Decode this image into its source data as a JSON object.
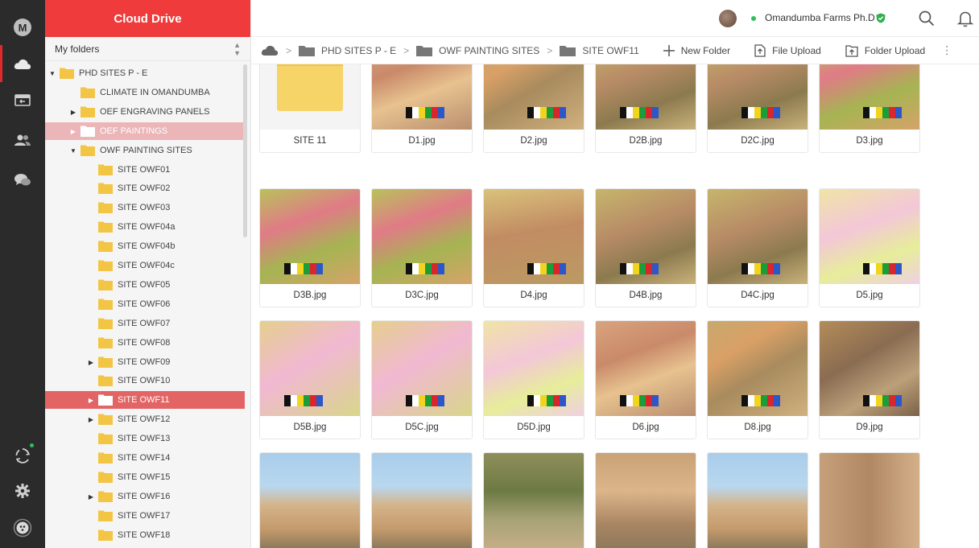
{
  "app": {
    "title": "Cloud Drive"
  },
  "tree": {
    "header": "My folders",
    "rows": [
      {
        "label": "PHD SITES P - E",
        "caret": "down",
        "depth": 0,
        "state": ""
      },
      {
        "label": "CLIMATE IN OMANDUMBA",
        "caret": "",
        "depth": 1,
        "state": ""
      },
      {
        "label": "OEF ENGRAVING PANELS",
        "caret": "right",
        "depth": 1,
        "state": ""
      },
      {
        "label": "OEF PAINTINGS",
        "caret": "right",
        "depth": 1,
        "state": "highlighted"
      },
      {
        "label": "OWF PAINTING SITES",
        "caret": "down",
        "depth": 1,
        "state": ""
      },
      {
        "label": "SITE OWF01",
        "caret": "",
        "depth": 2,
        "state": ""
      },
      {
        "label": "SITE OWF02",
        "caret": "",
        "depth": 2,
        "state": ""
      },
      {
        "label": "SITE OWF03",
        "caret": "",
        "depth": 2,
        "state": ""
      },
      {
        "label": "SITE OWF04a",
        "caret": "",
        "depth": 2,
        "state": ""
      },
      {
        "label": "SITE OWF04b",
        "caret": "",
        "depth": 2,
        "state": ""
      },
      {
        "label": "SITE OWF04c",
        "caret": "",
        "depth": 2,
        "state": ""
      },
      {
        "label": "SITE OWF05",
        "caret": "",
        "depth": 2,
        "state": ""
      },
      {
        "label": "SITE OWF06",
        "caret": "",
        "depth": 2,
        "state": ""
      },
      {
        "label": "SITE OWF07",
        "caret": "",
        "depth": 2,
        "state": ""
      },
      {
        "label": "SITE OWF08",
        "caret": "",
        "depth": 2,
        "state": ""
      },
      {
        "label": "SITE OWF09",
        "caret": "right",
        "depth": 2,
        "state": ""
      },
      {
        "label": "SITE OWF10",
        "caret": "",
        "depth": 2,
        "state": ""
      },
      {
        "label": "SITE OWF11",
        "caret": "right",
        "depth": 2,
        "state": "selected"
      },
      {
        "label": "SITE OWF12",
        "caret": "right",
        "depth": 2,
        "state": ""
      },
      {
        "label": "SITE OWF13",
        "caret": "",
        "depth": 2,
        "state": ""
      },
      {
        "label": "SITE OWF14",
        "caret": "",
        "depth": 2,
        "state": ""
      },
      {
        "label": "SITE OWF15",
        "caret": "",
        "depth": 2,
        "state": ""
      },
      {
        "label": "SITE OWF16",
        "caret": "right",
        "depth": 2,
        "state": ""
      },
      {
        "label": "SITE OWF17",
        "caret": "",
        "depth": 2,
        "state": ""
      },
      {
        "label": "SITE OWF18",
        "caret": "",
        "depth": 2,
        "state": ""
      }
    ]
  },
  "user": {
    "name": "Omandumba Farms Ph.D"
  },
  "breadcrumb": [
    "PHD SITES P - E",
    "OWF PAINTING SITES",
    "SITE OWF11"
  ],
  "toolbar": {
    "new_folder": "New Folder",
    "file_upload": "File Upload",
    "folder_upload": "Folder Upload"
  },
  "files": [
    {
      "name": "SITE 11",
      "type": "folder",
      "thumb": ""
    },
    {
      "name": "D1.jpg",
      "type": "image",
      "thumb": "t-rock1"
    },
    {
      "name": "D2.jpg",
      "type": "image",
      "thumb": "t-rock2"
    },
    {
      "name": "D2B.jpg",
      "type": "image",
      "thumb": "t-rock3"
    },
    {
      "name": "D2C.jpg",
      "type": "image",
      "thumb": "t-rock3"
    },
    {
      "name": "D3.jpg",
      "type": "image",
      "thumb": "t-vivid"
    },
    {
      "name": "D3B.jpg",
      "type": "image",
      "thumb": "t-vivid"
    },
    {
      "name": "D3C.jpg",
      "type": "image",
      "thumb": "t-vivid"
    },
    {
      "name": "D4.jpg",
      "type": "image",
      "thumb": "t-rock4"
    },
    {
      "name": "D4B.jpg",
      "type": "image",
      "thumb": "t-rock3"
    },
    {
      "name": "D4C.jpg",
      "type": "image",
      "thumb": "t-rock3"
    },
    {
      "name": "D5.jpg",
      "type": "image",
      "thumb": "t-pink"
    },
    {
      "name": "D5B.jpg",
      "type": "image",
      "thumb": "t-pink2"
    },
    {
      "name": "D5C.jpg",
      "type": "image",
      "thumb": "t-pink2"
    },
    {
      "name": "D5D.jpg",
      "type": "image",
      "thumb": "t-pink"
    },
    {
      "name": "D6.jpg",
      "type": "image",
      "thumb": "t-rock1"
    },
    {
      "name": "D8.jpg",
      "type": "image",
      "thumb": "t-rock2"
    },
    {
      "name": "D9.jpg",
      "type": "image",
      "thumb": "t-rock5"
    },
    {
      "name": "",
      "type": "image",
      "thumb": "t-sky"
    },
    {
      "name": "",
      "type": "image",
      "thumb": "t-sky"
    },
    {
      "name": "",
      "type": "image",
      "thumb": "t-brush"
    },
    {
      "name": "",
      "type": "image",
      "thumb": "t-boulder"
    },
    {
      "name": "",
      "type": "image",
      "thumb": "t-sky"
    },
    {
      "name": "",
      "type": "image",
      "thumb": "t-person"
    }
  ],
  "colors": {
    "brand": "#ef3b3b",
    "selected_row": "#e36464",
    "highlight_row": "#ecb5b8",
    "folder": "#f3c545",
    "online": "#2fbf5a"
  },
  "icons": [
    "mega-logo-icon",
    "cloud-drive-icon",
    "transfers-icon",
    "contacts-icon",
    "chat-icon",
    "rubbish-bin-icon",
    "settings-icon",
    "account-icon",
    "search-icon",
    "bell-icon",
    "shield-icon"
  ]
}
